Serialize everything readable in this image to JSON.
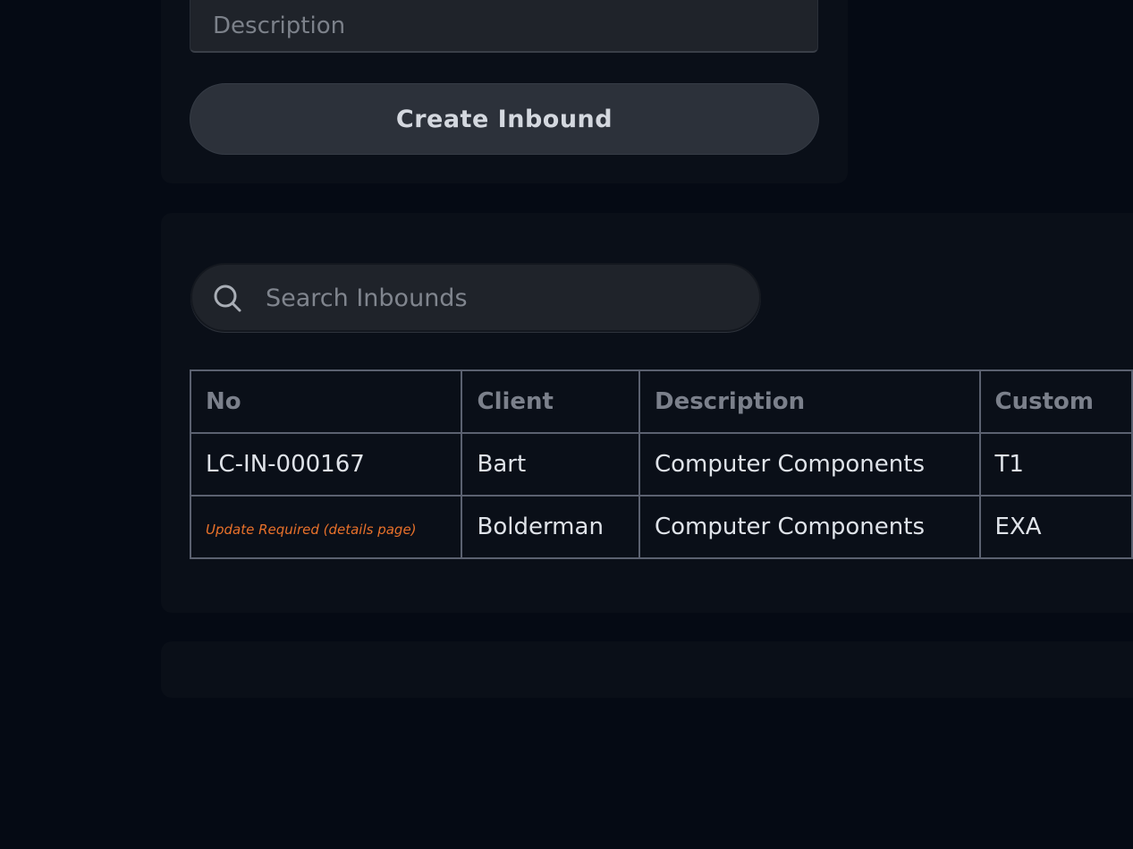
{
  "form": {
    "description_placeholder": "Description",
    "create_button_label": "Create Inbound"
  },
  "search": {
    "placeholder": "Search Inbounds",
    "icon": "search-icon"
  },
  "table": {
    "headers": [
      "No",
      "Client",
      "Description",
      "Custom"
    ],
    "rows": [
      {
        "no": "LC-IN-000167",
        "client": "Bart",
        "description": "Computer Components",
        "custom": "T1"
      },
      {
        "no": "Update Required (details page)",
        "client": "Bolderman",
        "description": "Computer Components",
        "custom": "EXA"
      }
    ]
  },
  "colors": {
    "background": "#050a14",
    "panel": "#0a0f18",
    "warning": "#e8712a"
  }
}
